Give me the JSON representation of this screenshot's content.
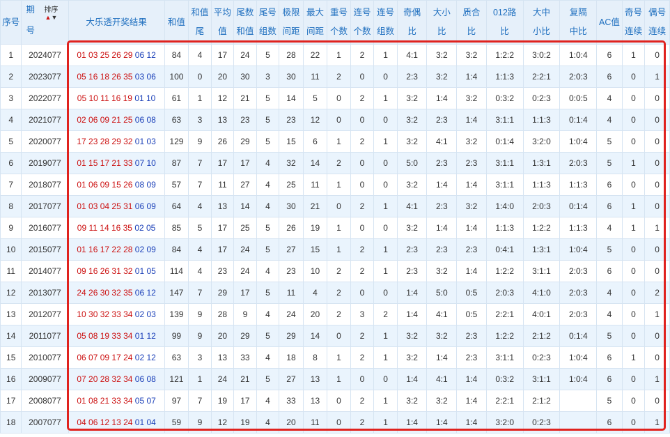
{
  "headers": {
    "no": "序号",
    "period_top": "期",
    "period_bottom": "号",
    "sort_label": "排序",
    "result": "大乐透开奖结果",
    "sum": "和值",
    "sum_tail_top": "和值",
    "sum_tail_bottom": "尾",
    "avg_top": "平均",
    "avg_bottom": "值",
    "tail_sum_top": "尾数",
    "tail_sum_bottom": "和值",
    "tail_group_top": "尾号",
    "tail_group_bottom": "组数",
    "limit_gap_top": "极限",
    "limit_gap_bottom": "间距",
    "max_gap_top": "最大",
    "max_gap_bottom": "间距",
    "repeat_top": "重号",
    "repeat_bottom": "个数",
    "consec_top": "连号",
    "consec_bottom": "个数",
    "consec_group_top": "连号",
    "consec_group_bottom": "组数",
    "odd_even_top": "奇偶",
    "odd_even_bottom": "比",
    "big_small_top": "大小",
    "big_small_bottom": "比",
    "prime_top": "质合",
    "prime_bottom": "比",
    "route_top": "012路",
    "route_bottom": "比",
    "bms_top": "大中",
    "bms_bottom": "小比",
    "region_top": "复隔",
    "region_bottom": "中比",
    "ac": "AC值",
    "odd_consec_top": "奇号",
    "odd_consec_bottom": "连续",
    "even_consec_top": "偶号",
    "even_consec_bottom": "连续"
  },
  "rows": [
    {
      "no": "1",
      "period": "2024077",
      "red": "01 03 25 26 29",
      "blue": "06 12",
      "sum": "84",
      "tail": "4",
      "avg": "17",
      "tailsum": "24",
      "tailgrp": "5",
      "limit": "28",
      "maxgap": "22",
      "rep": "1",
      "cons": "2",
      "consgrp": "1",
      "oe": "4:1",
      "bs": "3:2",
      "pc": "3:2",
      "r012": "1:2:2",
      "bms": "3:0:2",
      "reg": "1:0:4",
      "ac": "6",
      "oc": "1",
      "ec": "0"
    },
    {
      "no": "2",
      "period": "2023077",
      "red": "05 16 18 26 35",
      "blue": "03 06",
      "sum": "100",
      "tail": "0",
      "avg": "20",
      "tailsum": "30",
      "tailgrp": "3",
      "limit": "30",
      "maxgap": "11",
      "rep": "2",
      "cons": "0",
      "consgrp": "0",
      "oe": "2:3",
      "bs": "3:2",
      "pc": "1:4",
      "r012": "1:1:3",
      "bms": "2:2:1",
      "reg": "2:0:3",
      "ac": "6",
      "oc": "0",
      "ec": "1"
    },
    {
      "no": "3",
      "period": "2022077",
      "red": "05 10 11 16 19",
      "blue": "01 10",
      "sum": "61",
      "tail": "1",
      "avg": "12",
      "tailsum": "21",
      "tailgrp": "5",
      "limit": "14",
      "maxgap": "5",
      "rep": "0",
      "cons": "2",
      "consgrp": "1",
      "oe": "3:2",
      "bs": "1:4",
      "pc": "3:2",
      "r012": "0:3:2",
      "bms": "0:2:3",
      "reg": "0:0:5",
      "ac": "4",
      "oc": "0",
      "ec": "0"
    },
    {
      "no": "4",
      "period": "2021077",
      "red": "02 06 09 21 25",
      "blue": "06 08",
      "sum": "63",
      "tail": "3",
      "avg": "13",
      "tailsum": "23",
      "tailgrp": "5",
      "limit": "23",
      "maxgap": "12",
      "rep": "0",
      "cons": "0",
      "consgrp": "0",
      "oe": "3:2",
      "bs": "2:3",
      "pc": "1:4",
      "r012": "3:1:1",
      "bms": "1:1:3",
      "reg": "0:1:4",
      "ac": "4",
      "oc": "0",
      "ec": "0"
    },
    {
      "no": "5",
      "period": "2020077",
      "red": "17 23 28 29 32",
      "blue": "01 03",
      "sum": "129",
      "tail": "9",
      "avg": "26",
      "tailsum": "29",
      "tailgrp": "5",
      "limit": "15",
      "maxgap": "6",
      "rep": "1",
      "cons": "2",
      "consgrp": "1",
      "oe": "3:2",
      "bs": "4:1",
      "pc": "3:2",
      "r012": "0:1:4",
      "bms": "3:2:0",
      "reg": "1:0:4",
      "ac": "5",
      "oc": "0",
      "ec": "0"
    },
    {
      "no": "6",
      "period": "2019077",
      "red": "01 15 17 21 33",
      "blue": "07 10",
      "sum": "87",
      "tail": "7",
      "avg": "17",
      "tailsum": "17",
      "tailgrp": "4",
      "limit": "32",
      "maxgap": "14",
      "rep": "2",
      "cons": "0",
      "consgrp": "0",
      "oe": "5:0",
      "bs": "2:3",
      "pc": "2:3",
      "r012": "3:1:1",
      "bms": "1:3:1",
      "reg": "2:0:3",
      "ac": "5",
      "oc": "1",
      "ec": "0"
    },
    {
      "no": "7",
      "period": "2018077",
      "red": "01 06 09 15 26",
      "blue": "08 09",
      "sum": "57",
      "tail": "7",
      "avg": "11",
      "tailsum": "27",
      "tailgrp": "4",
      "limit": "25",
      "maxgap": "11",
      "rep": "1",
      "cons": "0",
      "consgrp": "0",
      "oe": "3:2",
      "bs": "1:4",
      "pc": "1:4",
      "r012": "3:1:1",
      "bms": "1:1:3",
      "reg": "1:1:3",
      "ac": "6",
      "oc": "0",
      "ec": "0"
    },
    {
      "no": "8",
      "period": "2017077",
      "red": "01 03 04 25 31",
      "blue": "06 09",
      "sum": "64",
      "tail": "4",
      "avg": "13",
      "tailsum": "14",
      "tailgrp": "4",
      "limit": "30",
      "maxgap": "21",
      "rep": "0",
      "cons": "2",
      "consgrp": "1",
      "oe": "4:1",
      "bs": "2:3",
      "pc": "3:2",
      "r012": "1:4:0",
      "bms": "2:0:3",
      "reg": "0:1:4",
      "ac": "6",
      "oc": "1",
      "ec": "0"
    },
    {
      "no": "9",
      "period": "2016077",
      "red": "09 11 14 16 35",
      "blue": "02 05",
      "sum": "85",
      "tail": "5",
      "avg": "17",
      "tailsum": "25",
      "tailgrp": "5",
      "limit": "26",
      "maxgap": "19",
      "rep": "1",
      "cons": "0",
      "consgrp": "0",
      "oe": "3:2",
      "bs": "1:4",
      "pc": "1:4",
      "r012": "1:1:3",
      "bms": "1:2:2",
      "reg": "1:1:3",
      "ac": "4",
      "oc": "1",
      "ec": "1"
    },
    {
      "no": "10",
      "period": "2015077",
      "red": "01 16 17 22 28",
      "blue": "02 09",
      "sum": "84",
      "tail": "4",
      "avg": "17",
      "tailsum": "24",
      "tailgrp": "5",
      "limit": "27",
      "maxgap": "15",
      "rep": "1",
      "cons": "2",
      "consgrp": "1",
      "oe": "2:3",
      "bs": "2:3",
      "pc": "2:3",
      "r012": "0:4:1",
      "bms": "1:3:1",
      "reg": "1:0:4",
      "ac": "5",
      "oc": "0",
      "ec": "0"
    },
    {
      "no": "11",
      "period": "2014077",
      "red": "09 16 26 31 32",
      "blue": "01 05",
      "sum": "114",
      "tail": "4",
      "avg": "23",
      "tailsum": "24",
      "tailgrp": "4",
      "limit": "23",
      "maxgap": "10",
      "rep": "2",
      "cons": "2",
      "consgrp": "1",
      "oe": "2:3",
      "bs": "3:2",
      "pc": "1:4",
      "r012": "1:2:2",
      "bms": "3:1:1",
      "reg": "2:0:3",
      "ac": "6",
      "oc": "0",
      "ec": "0"
    },
    {
      "no": "12",
      "period": "2013077",
      "red": "24 26 30 32 35",
      "blue": "06 12",
      "sum": "147",
      "tail": "7",
      "avg": "29",
      "tailsum": "17",
      "tailgrp": "5",
      "limit": "11",
      "maxgap": "4",
      "rep": "2",
      "cons": "0",
      "consgrp": "0",
      "oe": "1:4",
      "bs": "5:0",
      "pc": "0:5",
      "r012": "2:0:3",
      "bms": "4:1:0",
      "reg": "2:0:3",
      "ac": "4",
      "oc": "0",
      "ec": "2"
    },
    {
      "no": "13",
      "period": "2012077",
      "red": "10 30 32 33 34",
      "blue": "02 03",
      "sum": "139",
      "tail": "9",
      "avg": "28",
      "tailsum": "9",
      "tailgrp": "4",
      "limit": "24",
      "maxgap": "20",
      "rep": "2",
      "cons": "3",
      "consgrp": "2",
      "oe": "1:4",
      "bs": "4:1",
      "pc": "0:5",
      "r012": "2:2:1",
      "bms": "4:0:1",
      "reg": "2:0:3",
      "ac": "4",
      "oc": "0",
      "ec": "1"
    },
    {
      "no": "14",
      "period": "2011077",
      "red": "05 08 19 33 34",
      "blue": "01 12",
      "sum": "99",
      "tail": "9",
      "avg": "20",
      "tailsum": "29",
      "tailgrp": "5",
      "limit": "29",
      "maxgap": "14",
      "rep": "0",
      "cons": "2",
      "consgrp": "1",
      "oe": "3:2",
      "bs": "3:2",
      "pc": "2:3",
      "r012": "1:2:2",
      "bms": "2:1:2",
      "reg": "0:1:4",
      "ac": "5",
      "oc": "0",
      "ec": "0"
    },
    {
      "no": "15",
      "period": "2010077",
      "red": "06 07 09 17 24",
      "blue": "02 12",
      "sum": "63",
      "tail": "3",
      "avg": "13",
      "tailsum": "33",
      "tailgrp": "4",
      "limit": "18",
      "maxgap": "8",
      "rep": "1",
      "cons": "2",
      "consgrp": "1",
      "oe": "3:2",
      "bs": "1:4",
      "pc": "2:3",
      "r012": "3:1:1",
      "bms": "0:2:3",
      "reg": "1:0:4",
      "ac": "6",
      "oc": "1",
      "ec": "0"
    },
    {
      "no": "16",
      "period": "2009077",
      "red": "07 20 28 32 34",
      "blue": "06 08",
      "sum": "121",
      "tail": "1",
      "avg": "24",
      "tailsum": "21",
      "tailgrp": "5",
      "limit": "27",
      "maxgap": "13",
      "rep": "1",
      "cons": "0",
      "consgrp": "0",
      "oe": "1:4",
      "bs": "4:1",
      "pc": "1:4",
      "r012": "0:3:2",
      "bms": "3:1:1",
      "reg": "1:0:4",
      "ac": "6",
      "oc": "0",
      "ec": "1"
    },
    {
      "no": "17",
      "period": "2008077",
      "red": "01 08 21 33 34",
      "blue": "05 07",
      "sum": "97",
      "tail": "7",
      "avg": "19",
      "tailsum": "17",
      "tailgrp": "4",
      "limit": "33",
      "maxgap": "13",
      "rep": "0",
      "cons": "2",
      "consgrp": "1",
      "oe": "3:2",
      "bs": "3:2",
      "pc": "1:4",
      "r012": "2:2:1",
      "bms": "2:1:2",
      "reg": "",
      "ac": "5",
      "oc": "0",
      "ec": "0"
    },
    {
      "no": "18",
      "period": "2007077",
      "red": "04 06 12 13 24",
      "blue": "01 04",
      "sum": "59",
      "tail": "9",
      "avg": "12",
      "tailsum": "19",
      "tailgrp": "4",
      "limit": "20",
      "maxgap": "11",
      "rep": "0",
      "cons": "2",
      "consgrp": "1",
      "oe": "1:4",
      "bs": "1:4",
      "pc": "1:4",
      "r012": "3:2:0",
      "bms": "0:2:3",
      "reg": "",
      "ac": "6",
      "oc": "0",
      "ec": "1"
    }
  ],
  "colors": {
    "red_ball": "#cc1111",
    "blue_ball": "#1a3fb8",
    "header_text": "#1f6fbf",
    "highlight": "#e0221e"
  }
}
